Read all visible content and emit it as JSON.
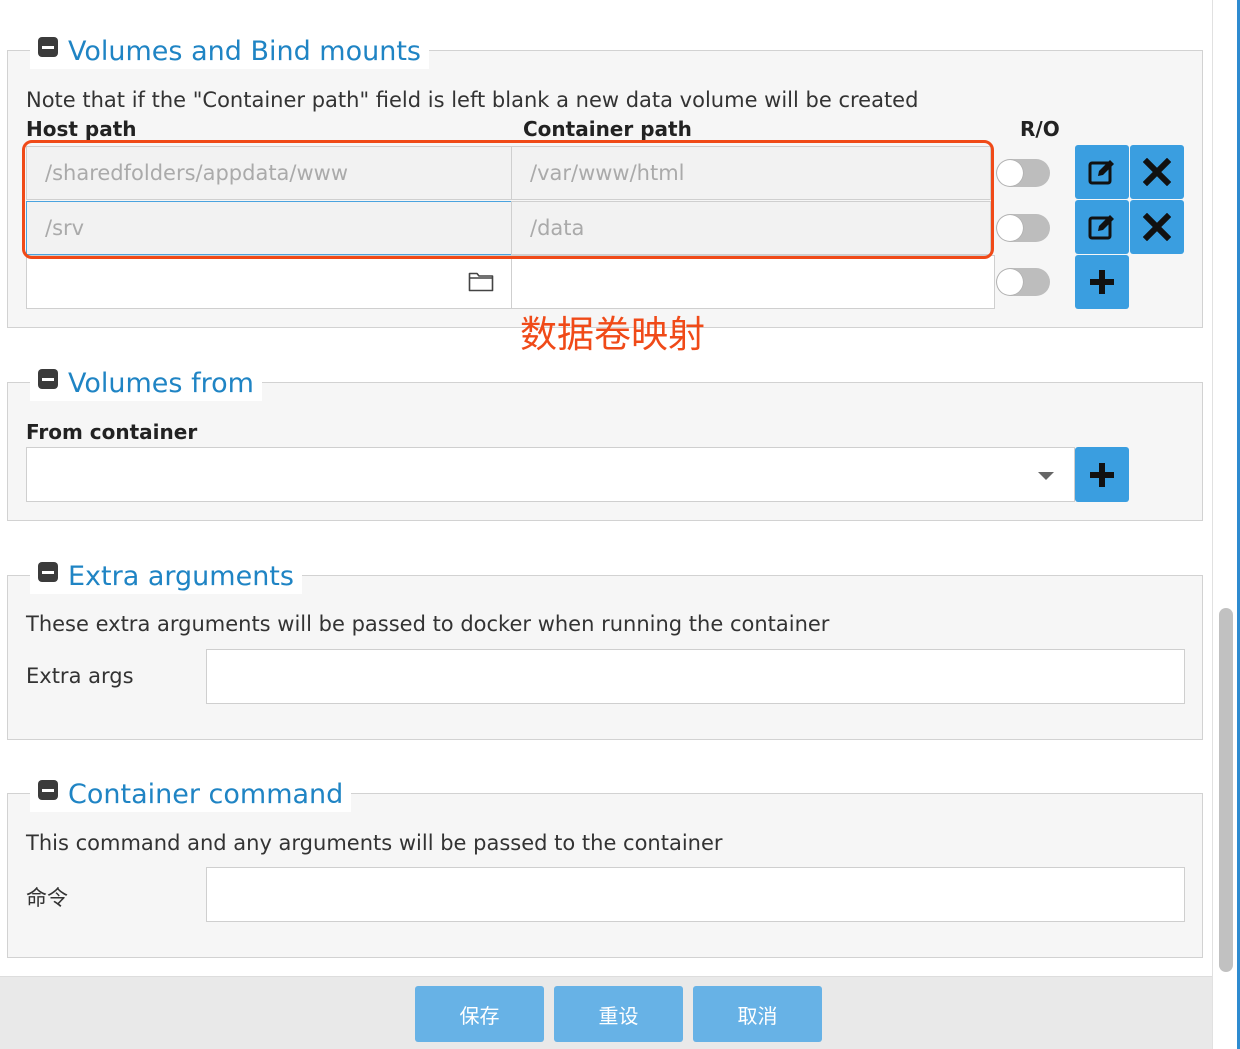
{
  "volumes": {
    "title": "Volumes and Bind mounts",
    "note": "Note that if the \"Container path\" field is left blank a new data volume will be created",
    "host_path_header": "Host path",
    "container_path_header": "Container path",
    "ro_header": "R/O",
    "rows": [
      {
        "host_path": "/sharedfolders/appdata/www",
        "container_path": "/var/www/html"
      },
      {
        "host_path": "/srv",
        "container_path": "/data"
      }
    ],
    "new_row": {
      "host_path": "",
      "container_path": ""
    },
    "annotation": "数据卷映射"
  },
  "volumes_from": {
    "title": "Volumes from",
    "from_container_label": "From container",
    "selected_value": ""
  },
  "extra_arguments": {
    "title": "Extra arguments",
    "description": "These extra arguments will be passed to docker when running the container",
    "label": "Extra args",
    "value": ""
  },
  "container_command": {
    "title": "Container command",
    "description": "This command and any arguments will be passed to the container",
    "label": "命令",
    "value": ""
  },
  "footer": {
    "save_label": "保存",
    "reset_label": "重设",
    "cancel_label": "取消"
  },
  "colors": {
    "accent": "#3a9ee0",
    "legend_title": "#1f84c4",
    "annotation": "#f04a18",
    "footer_button": "#67b2e6"
  },
  "icons": {
    "collapse": "minus-square-icon",
    "edit": "edit-icon",
    "delete": "close-icon",
    "add": "plus-icon",
    "folder": "folder-icon",
    "dropdown": "caret-down-icon"
  }
}
